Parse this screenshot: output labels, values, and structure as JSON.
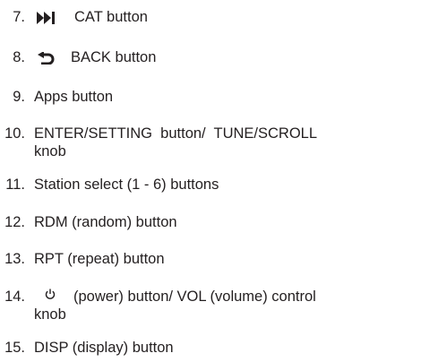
{
  "items": [
    {
      "number": "7.",
      "label": "CAT button",
      "icon": "skip-forward-icon"
    },
    {
      "number": "8.",
      "label": "BACK button",
      "icon": "back-arrow-icon"
    },
    {
      "number": "9.",
      "label": "Apps button"
    },
    {
      "number": "10.",
      "label_line1": "ENTER/SETTING  button/  TUNE/SCROLL",
      "label_line2": "knob"
    },
    {
      "number": "11.",
      "label": "Station select (1 - 6) buttons"
    },
    {
      "number": "12.",
      "label": "RDM (random) button"
    },
    {
      "number": "13.",
      "label": "RPT (repeat) button"
    },
    {
      "number": "14.",
      "label_line1": "(power) button/ VOL (volume) control",
      "label_line2": "knob",
      "icon": "power-icon"
    },
    {
      "number": "15.",
      "label": "DISP (display) button"
    }
  ]
}
